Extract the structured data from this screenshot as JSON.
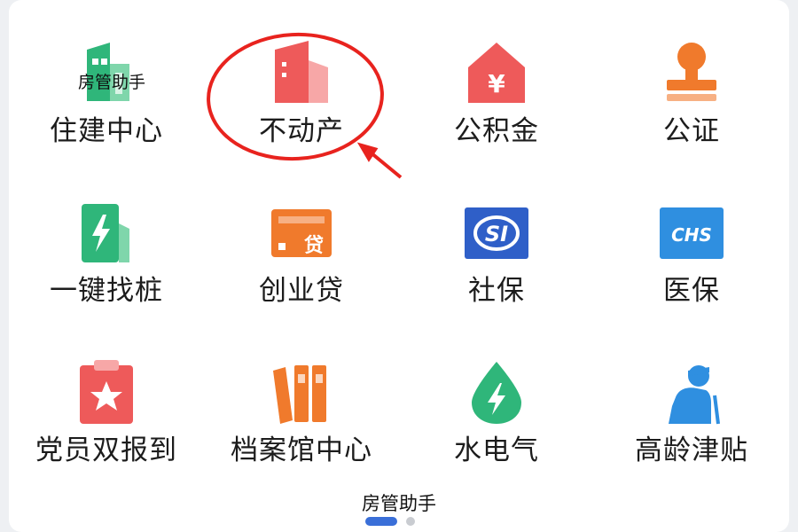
{
  "grid": {
    "items": [
      {
        "label": "住建中心",
        "icon": "building-icon",
        "color": "#2fb67a"
      },
      {
        "label": "不动产",
        "icon": "real-estate-icon",
        "color": "#ee5a5a"
      },
      {
        "label": "公积金",
        "icon": "housing-fund-icon",
        "color": "#ee5a5a"
      },
      {
        "label": "公证",
        "icon": "notary-seal-icon",
        "color": "#f07a2c"
      },
      {
        "label": "一键找桩",
        "icon": "charging-station-icon",
        "color": "#2fb67a"
      },
      {
        "label": "创业贷",
        "icon": "loan-card-icon",
        "color": "#f07a2c"
      },
      {
        "label": "社保",
        "icon": "social-security-icon",
        "color": "#2f5fc8"
      },
      {
        "label": "医保",
        "icon": "medical-insurance-icon",
        "color": "#2f8fe0"
      },
      {
        "label": "党员双报到",
        "icon": "clipboard-star-icon",
        "color": "#ee5a5a"
      },
      {
        "label": "档案馆中心",
        "icon": "archive-binders-icon",
        "color": "#f07a2c"
      },
      {
        "label": "水电气",
        "icon": "water-drop-bolt-icon",
        "color": "#2fb67a"
      },
      {
        "label": "高龄津贴",
        "icon": "elderly-person-icon",
        "color": "#2f8fe0"
      }
    ]
  },
  "icon_text": {
    "loan": "贷",
    "social": "SI",
    "medical": "CHS",
    "fund": "¥"
  },
  "watermark": {
    "top": "房管助手",
    "bottom": "房管助手"
  },
  "pagination": {
    "pages": 2,
    "current": 1
  },
  "annotation": {
    "color": "#e8231e",
    "target": "不动产"
  }
}
